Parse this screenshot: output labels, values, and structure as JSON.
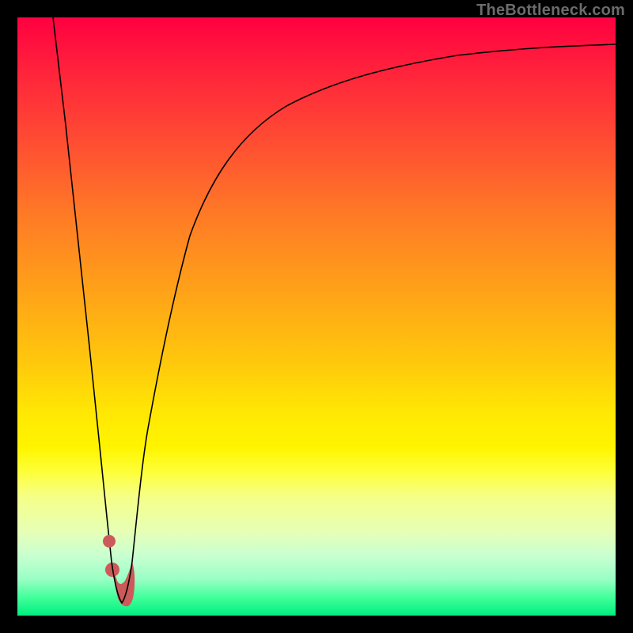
{
  "watermark": "TheBottleneck.com",
  "colors": {
    "frame": "#000000",
    "curve": "#000000",
    "marker": "#cc5a5a",
    "gradient_top": "#ff0040",
    "gradient_bottom": "#00ef7e"
  },
  "chart_data": {
    "type": "line",
    "title": "",
    "xlabel": "",
    "ylabel": "",
    "xlim": [
      0,
      100
    ],
    "ylim": [
      0,
      100
    ],
    "grid": false,
    "legend": false,
    "note": "No axis tick labels are rendered; x is treated as 0–100 across the plot width and y as 0 (bottom) to 100 (top). Values are read off pixel positions and rounded.",
    "series": [
      {
        "name": "left-branch",
        "x": [
          6.0,
          8.0,
          10.0,
          12.0,
          13.9,
          15.0,
          15.8
        ],
        "y": [
          100.0,
          82.0,
          63.5,
          45.0,
          27.0,
          16.5,
          9.0
        ]
      },
      {
        "name": "right-branch",
        "x": [
          19.2,
          20.5,
          22.0,
          24.0,
          27.0,
          31.0,
          36.0,
          42.0,
          50.0,
          60.0,
          72.0,
          86.0,
          100.0
        ],
        "y": [
          9.0,
          20.0,
          32.0,
          44.0,
          56.5,
          67.0,
          75.5,
          82.0,
          87.0,
          90.5,
          93.0,
          94.5,
          95.5
        ]
      },
      {
        "name": "valley-marker",
        "x": [
          15.8,
          16.4,
          17.0,
          17.5,
          18.0,
          18.6,
          19.2
        ],
        "y": [
          9.0,
          5.0,
          2.5,
          2.0,
          2.5,
          5.0,
          9.0
        ]
      }
    ],
    "annotations": [
      {
        "type": "dot",
        "x": 15.4,
        "y": 12.5
      },
      {
        "type": "dot",
        "x": 15.9,
        "y": 7.5
      }
    ]
  }
}
